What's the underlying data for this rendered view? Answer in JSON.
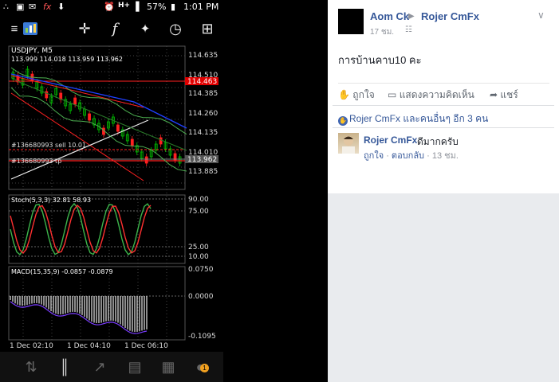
{
  "status": {
    "battery": "57%",
    "time": "1:01 PM",
    "fx_label": "fx"
  },
  "chart": {
    "symbol": "USDJPY, M5",
    "ohlc": "113.999 114.018 113.959 113.962",
    "price_axis": [
      "114.635",
      "114.510",
      "114.385",
      "114.260",
      "114.135",
      "114.010",
      "113.885"
    ],
    "hline_red": "114.463",
    "current_price": "113.962",
    "order_sell": "#136680993 sell 10.01",
    "order_tp": "#136680993 tp",
    "stoch_label": "Stoch(5,3,3) 32.81 58.93",
    "stoch_axis": [
      "90.00",
      "75.00",
      "25.00",
      "10.00"
    ],
    "macd_label": "MACD(15,35,9) -0.0857 -0.0879",
    "macd_axis": [
      "0.0750",
      "0.0000",
      "-0.1095"
    ],
    "time_axis": [
      "1 Dec 02:10",
      "1 Dec 04:10",
      "1 Dec 06:10"
    ],
    "colors": {
      "bull": "#00c000",
      "bear": "#ff2020",
      "ma": "#2040ff",
      "band": "#4caf50"
    }
  },
  "icons": {
    "toolbar": [
      "mt4-logo-icon",
      "crosshair-icon",
      "function-icon",
      "indicators-icon",
      "clock-icon",
      "add-object-icon"
    ],
    "bottom": [
      "quotes-icon",
      "chart-icon",
      "trade-icon",
      "history-icon",
      "news-icon",
      "chat-icon"
    ]
  },
  "badge": "1",
  "fb": {
    "author": "Aom Ck",
    "target": "Rojer CmFx",
    "time": "17 ชม.",
    "post_text": "การบ้านคาบ10 คะ",
    "actions": {
      "like": "ถูกใจ",
      "comment": "แสดงความคิดเห็น",
      "share": "แชร์"
    },
    "likes_text": "Rojer CmFx และคนอื่นๆ อีก 3 คน",
    "comment": {
      "name": "Rojer CmFx",
      "text": "ดีมากครับ",
      "like": "ถูกใจ",
      "reply": "ตอบกลับ",
      "time": "13 ชม."
    },
    "colors": {
      "link": "#365899",
      "text": "#1d2129",
      "meta": "#90949c"
    }
  }
}
